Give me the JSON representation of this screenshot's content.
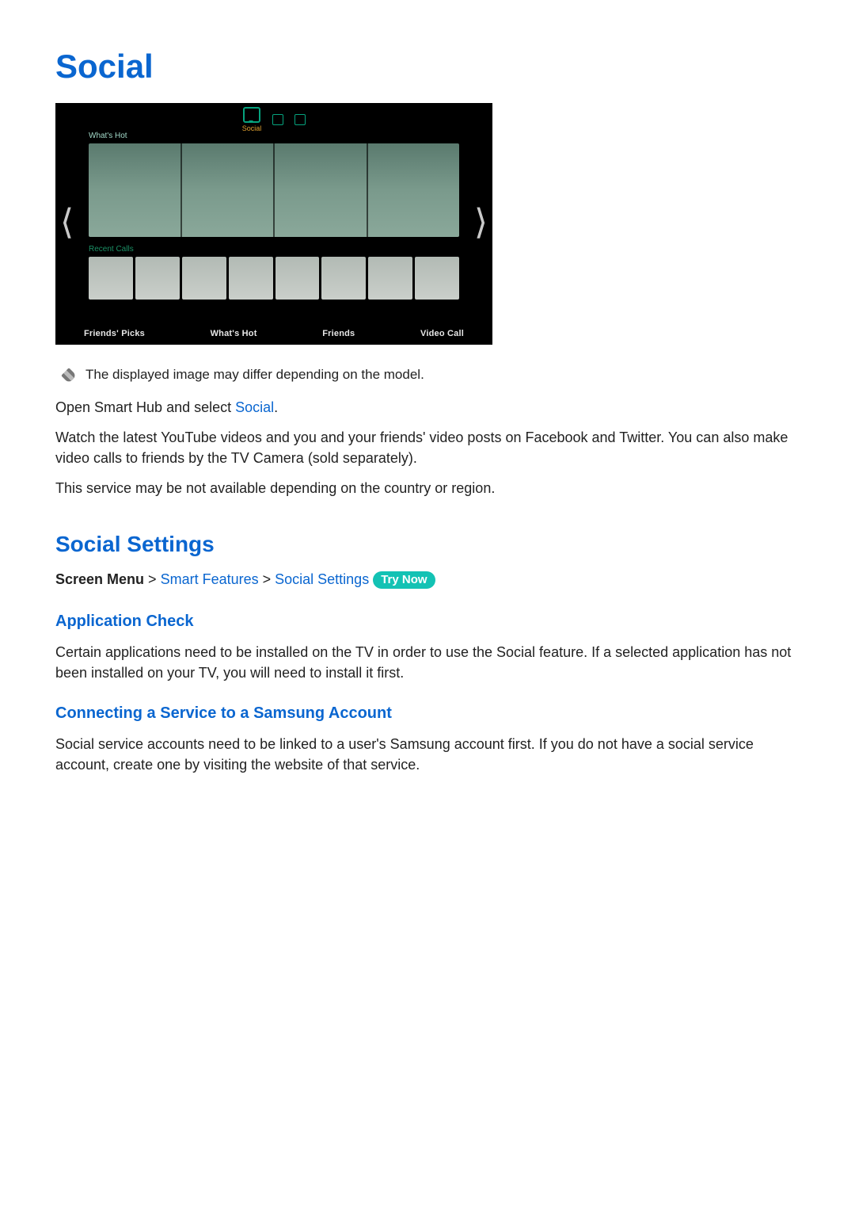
{
  "title": "Social",
  "tv": {
    "social_label": "Social",
    "whats_hot_label": "What's Hot",
    "recent_calls_label": "Recent Calls",
    "tabs": [
      "Friends' Picks",
      "What's Hot",
      "Friends",
      "Video Call"
    ]
  },
  "note": "The displayed image may differ depending on the model.",
  "para_open_pre": "Open Smart Hub and select ",
  "para_open_link": "Social",
  "para_open_post": ".",
  "para_watch": "Watch the latest YouTube videos and you and your friends' video posts on Facebook and Twitter. You can also make video calls to friends by the TV Camera (sold separately).",
  "para_avail": "This service may be not available depending on the country or region.",
  "sec_settings": "Social Settings",
  "path": {
    "b1": "Screen Menu",
    "sep": " > ",
    "k1": "Smart Features",
    "k2": "Social Settings",
    "try": "Try Now"
  },
  "sub_appcheck": "Application Check",
  "para_appcheck": "Certain applications need to be installed on the TV in order to use the Social feature. If a selected application has not been installed on your TV, you will need to install it first.",
  "sub_connect": "Connecting a Service to a Samsung Account",
  "para_connect": "Social service accounts need to be linked to a user's Samsung account first. If you do not have a social service account, create one by visiting the website of that service."
}
